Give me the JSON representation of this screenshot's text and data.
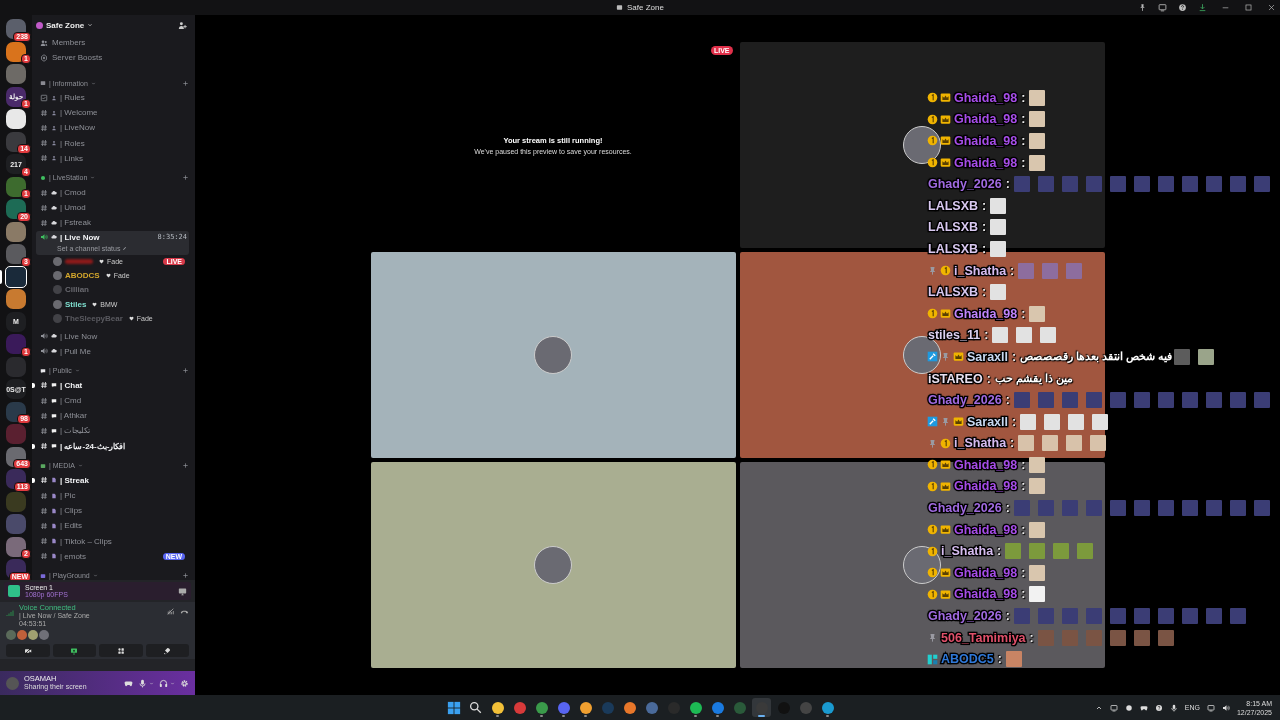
{
  "title_bar": {
    "title": "Safe Zone"
  },
  "servers": [
    {
      "color": "#5b5f6b",
      "badge": "238",
      "selected": false
    },
    {
      "color": "#d9731c",
      "badge": "1",
      "selected": false
    },
    {
      "color": "#6d6a66",
      "selected": false
    },
    {
      "color": "#4a2a6a",
      "label": "حولة",
      "badge": "1",
      "selected": false
    },
    {
      "color": "#e8e8e8",
      "selected": false
    },
    {
      "color": "#3a3a3e",
      "badge": "14",
      "selected": false
    },
    {
      "color": "#1e1f22",
      "label": "217",
      "badge": "4",
      "selected": false
    },
    {
      "color": "#3d6b2e",
      "badge": "1",
      "selected": false
    },
    {
      "color": "#1d6b55",
      "badge": "20",
      "selected": false
    },
    {
      "color": "#8a7a66",
      "selected": false
    },
    {
      "color": "#5a5a5e",
      "badge": "3",
      "selected": false
    },
    {
      "color": "#1a2a3a",
      "selected": true
    },
    {
      "color": "#c87a30",
      "selected": false
    },
    {
      "color": "#1e1f22",
      "label": "M",
      "selected": false
    },
    {
      "color": "#3a1a5a",
      "badge": "1",
      "selected": false
    },
    {
      "color": "#2a2a2e",
      "selected": false
    },
    {
      "color": "#1e1f22",
      "label": "0S@T",
      "selected": false
    },
    {
      "color": "#2a3a4a",
      "badge": "98",
      "selected": false
    },
    {
      "color": "#5a2030",
      "selected": false
    },
    {
      "color": "#6a6a70",
      "badge": "643",
      "selected": false
    },
    {
      "color": "#3a2a5a",
      "badge": "113",
      "selected": false
    },
    {
      "color": "#3a3a20",
      "selected": false
    },
    {
      "color": "#4a4a6a",
      "selected": false
    },
    {
      "color": "#7a6a7a",
      "badge": "2",
      "selected": false
    },
    {
      "color": "#3a2a5a",
      "badge": "NEW",
      "selected": false
    }
  ],
  "server": {
    "name": "Safe Zone",
    "links": [
      {
        "label": "Members",
        "kind": "members"
      },
      {
        "label": "Server Boosts",
        "kind": "boost"
      }
    ]
  },
  "categories": [
    {
      "name": "| Information",
      "kind": "info",
      "channels": [
        {
          "name": "| Rules",
          "kind": "rules",
          "selected": false,
          "unread": false
        },
        {
          "name": "| Welcome",
          "kind": "text",
          "selected": false,
          "unread": false
        },
        {
          "name": "| LiveNow",
          "kind": "text",
          "selected": false,
          "unread": false
        },
        {
          "name": "| Roles",
          "kind": "text",
          "selected": false,
          "unread": false
        },
        {
          "name": "| Links",
          "kind": "text",
          "selected": false,
          "unread": false
        }
      ]
    },
    {
      "name": "| LiveStation",
      "kind": "live",
      "channels": [
        {
          "name": "| Cmod",
          "kind": "text",
          "selected": false,
          "unread": false
        },
        {
          "name": "| Umod",
          "kind": "text",
          "selected": false,
          "unread": false
        },
        {
          "name": "| Fstreak",
          "kind": "text",
          "selected": false,
          "unread": false
        },
        {
          "name": "| Live Now",
          "kind": "voice",
          "selected": true,
          "unread": true,
          "timer": "8:35:24",
          "status": "Set a channel status",
          "members": [
            {
              "redacted": true,
              "color": "#8a1a1a",
              "tag": "Fade",
              "live": "LIVE",
              "dimmed": false
            },
            {
              "name": "ABODCS",
              "color": "#d4a72c",
              "tag": "Fade",
              "dimmed": false
            },
            {
              "name": "Cillian",
              "color": "#6a6a70",
              "dimmed": true
            },
            {
              "name": "Stiles",
              "color": "#7fe0d0",
              "tag": "BMW",
              "dimmed": false
            },
            {
              "name": "TheSleepyBear",
              "color": "#5a5a60",
              "tag": "Fade",
              "dimmed": true
            }
          ]
        },
        {
          "name": "| Live Now",
          "kind": "voice",
          "selected": false,
          "unread": false
        },
        {
          "name": "| Pull Me",
          "kind": "voice",
          "selected": false,
          "unread": false
        }
      ]
    },
    {
      "name": "| Public",
      "kind": "chat",
      "channels": [
        {
          "name": "| Chat",
          "kind": "text",
          "selected": false,
          "unread": true
        },
        {
          "name": "| Cmd",
          "kind": "text",
          "selected": false,
          "unread": false
        },
        {
          "name": "| Athkar",
          "kind": "text",
          "selected": false,
          "unread": false
        },
        {
          "name": "| تكليجات",
          "kind": "text",
          "selected": false,
          "unread": false
        },
        {
          "name": "| افكار-بث-24-ساعه",
          "kind": "text",
          "selected": false,
          "unread": true
        }
      ]
    },
    {
      "name": "| MEDIA",
      "kind": "media",
      "channels": [
        {
          "name": "| Streak",
          "kind": "text",
          "selected": false,
          "unread": true
        },
        {
          "name": "| Pic",
          "kind": "text",
          "selected": false,
          "unread": false
        },
        {
          "name": "| Clips",
          "kind": "text",
          "selected": false,
          "unread": false
        },
        {
          "name": "| Edits",
          "kind": "text",
          "selected": false,
          "unread": false
        },
        {
          "name": "| Tiktok – Clips",
          "kind": "text",
          "selected": false,
          "unread": false
        },
        {
          "name": "| emots",
          "kind": "text",
          "selected": false,
          "unread": false,
          "badge": "NEW"
        }
      ]
    },
    {
      "name": "| PlayGround",
      "kind": "game"
    }
  ],
  "screen_share": {
    "title": "Screen 1",
    "quality": "1080p 60FPS"
  },
  "voice": {
    "status": "Voice Connected",
    "channel": "| Live Now / Safe Zone",
    "elapsed": "04:53:51",
    "participants": [
      {
        "color": "#5a6a5a"
      },
      {
        "color": "#c0603a"
      },
      {
        "color": "#a0a070"
      },
      {
        "color": "#707078"
      }
    ]
  },
  "user": {
    "name": "OSAMAH",
    "status": "Sharing their screen"
  },
  "tiles": [
    {
      "kind": "stream",
      "live": "LIVE",
      "title": "Your stream is still running!",
      "message": "We've paused this preview to save your resources."
    },
    {
      "kind": "avatar",
      "color": "#1e1e1e"
    },
    {
      "kind": "avatar",
      "color": "#a4b3ba"
    },
    {
      "kind": "avatar",
      "color": "#a1563f"
    },
    {
      "kind": "avatar",
      "color": "#a9ae91"
    },
    {
      "kind": "avatar",
      "color": "#5b595d"
    }
  ],
  "chat": [
    {
      "user": "Ghaida_98",
      "sep": ":",
      "color": "#a64de8",
      "badges": [
        {
          "kind": "coin"
        },
        {
          "kind": "crown"
        }
      ],
      "emotes": [
        {
          "kind": "ghaida"
        }
      ]
    },
    {
      "user": "Ghaida_98",
      "sep": ":",
      "color": "#a64de8",
      "badges": [
        {
          "kind": "coin"
        },
        {
          "kind": "crown"
        }
      ],
      "emotes": [
        {
          "kind": "ghaida"
        }
      ]
    },
    {
      "user": "Ghaida_98",
      "sep": ":",
      "color": "#a64de8",
      "badges": [
        {
          "kind": "coin"
        },
        {
          "kind": "crown"
        }
      ],
      "emotes": [
        {
          "kind": "ghaida"
        }
      ]
    },
    {
      "user": "Ghaida_98",
      "sep": ":",
      "color": "#a64de8",
      "badges": [
        {
          "kind": "coin"
        },
        {
          "kind": "crown"
        }
      ],
      "emotes": [
        {
          "kind": "ghaida"
        }
      ]
    },
    {
      "user": "Ghady_2026",
      "sep": ":",
      "color": "#a06ae0",
      "emotes": [
        {
          "kind": "ghady"
        },
        {
          "kind": "ghady"
        },
        {
          "kind": "ghady"
        },
        {
          "kind": "ghady"
        },
        {
          "kind": "ghady"
        },
        {
          "kind": "ghady"
        },
        {
          "kind": "ghady"
        },
        {
          "kind": "ghady"
        },
        {
          "kind": "ghady"
        },
        {
          "kind": "ghady"
        },
        {
          "kind": "ghady"
        }
      ]
    },
    {
      "user": "LALSXB",
      "sep": ":",
      "color": "#d8c8f0",
      "emotes": [
        {
          "kind": "lalsxb"
        }
      ]
    },
    {
      "user": "LALSXB",
      "sep": ":",
      "color": "#d8c8f0",
      "emotes": [
        {
          "kind": "lalsxb"
        }
      ]
    },
    {
      "user": "LALSXB",
      "sep": ":",
      "color": "#d8c8f0",
      "emotes": [
        {
          "kind": "lalsxb"
        }
      ]
    },
    {
      "user": "i_Shatha",
      "sep": ":",
      "color": "#d6bcf0",
      "badges": [
        {
          "kind": "pin"
        },
        {
          "kind": "coin"
        }
      ],
      "emotes": [
        {
          "kind": "pinkbird"
        },
        {
          "kind": "pinkbird"
        },
        {
          "kind": "pinkbird"
        }
      ]
    },
    {
      "user": "LALSXB",
      "sep": ":",
      "color": "#d8c8f0",
      "emotes": [
        {
          "kind": "lalsxb"
        }
      ]
    },
    {
      "user": "Ghaida_98",
      "sep": ":",
      "color": "#c084fc",
      "badges": [
        {
          "kind": "coin"
        },
        {
          "kind": "crown"
        }
      ],
      "emotes": [
        {
          "kind": "ghaida"
        }
      ]
    },
    {
      "user": "stiles_11",
      "sep": ":",
      "color": "#dcd0f0",
      "emotes": [
        {
          "kind": "lalsxb"
        },
        {
          "kind": "lalsxb"
        },
        {
          "kind": "lalsxb"
        }
      ]
    },
    {
      "user": "Saraxll",
      "sep": ":",
      "color": "#c8d8f0",
      "badges": [
        {
          "kind": "mod"
        },
        {
          "kind": "pin"
        },
        {
          "kind": "crown"
        }
      ],
      "text": "فيه شخص انتقد بعدها رقصصصص",
      "emotes": [
        {
          "kind": "man"
        },
        {
          "kind": "face"
        }
      ]
    },
    {
      "user": "iSTAREO",
      "sep": ":",
      "color": "#e8e0f0",
      "text": "مين ذا يقشم حب"
    },
    {
      "user": "Ghady_2026",
      "sep": ":",
      "color": "#a06ae0",
      "emotes": [
        {
          "kind": "ghady"
        },
        {
          "kind": "ghady"
        },
        {
          "kind": "ghady"
        },
        {
          "kind": "ghady"
        },
        {
          "kind": "ghady"
        },
        {
          "kind": "ghady"
        },
        {
          "kind": "ghady"
        },
        {
          "kind": "ghady"
        },
        {
          "kind": "ghady"
        },
        {
          "kind": "ghady"
        },
        {
          "kind": "ghady"
        }
      ]
    },
    {
      "user": "Saraxll",
      "sep": ":",
      "color": "#c8d8f0",
      "badges": [
        {
          "kind": "mod"
        },
        {
          "kind": "pin"
        },
        {
          "kind": "crown"
        }
      ],
      "emotes": [
        {
          "kind": "lalsxb"
        },
        {
          "kind": "lalsxb"
        },
        {
          "kind": "lalsxb"
        },
        {
          "kind": "lalsxb"
        }
      ]
    },
    {
      "user": "i_Shatha",
      "sep": ":",
      "color": "#d6bcf0",
      "badges": [
        {
          "kind": "pin"
        },
        {
          "kind": "coin"
        }
      ],
      "emotes": [
        {
          "kind": "pale"
        },
        {
          "kind": "pale"
        },
        {
          "kind": "pale"
        },
        {
          "kind": "pale"
        }
      ]
    },
    {
      "user": "Ghaida_98",
      "sep": ":",
      "color": "#a64de8",
      "badges": [
        {
          "kind": "coin"
        },
        {
          "kind": "crown"
        }
      ],
      "emotes": [
        {
          "kind": "ghaida"
        }
      ]
    },
    {
      "user": "Ghaida_98",
      "sep": ":",
      "color": "#a64de8",
      "badges": [
        {
          "kind": "coin"
        },
        {
          "kind": "crown"
        }
      ],
      "emotes": [
        {
          "kind": "ghaida"
        }
      ]
    },
    {
      "user": "Ghady_2026",
      "sep": ":",
      "color": "#a06ae0",
      "emotes": [
        {
          "kind": "ghady"
        },
        {
          "kind": "ghady"
        },
        {
          "kind": "ghady"
        },
        {
          "kind": "ghady"
        },
        {
          "kind": "ghady"
        },
        {
          "kind": "ghady"
        },
        {
          "kind": "ghady"
        },
        {
          "kind": "ghady"
        },
        {
          "kind": "ghady"
        },
        {
          "kind": "ghady"
        },
        {
          "kind": "ghady"
        }
      ]
    },
    {
      "user": "Ghaida_98",
      "sep": ":",
      "color": "#a64de8",
      "badges": [
        {
          "kind": "coin"
        },
        {
          "kind": "crown"
        }
      ],
      "emotes": [
        {
          "kind": "ghaida"
        }
      ]
    },
    {
      "user": "i_Shatha",
      "sep": ":",
      "color": "#d6bcf0",
      "badges": [
        {
          "kind": "coin"
        }
      ],
      "emotes": [
        {
          "kind": "green"
        },
        {
          "kind": "green"
        },
        {
          "kind": "green"
        },
        {
          "kind": "green"
        }
      ]
    },
    {
      "user": "Ghaida_98",
      "sep": ":",
      "color": "#a64de8",
      "badges": [
        {
          "kind": "coin"
        },
        {
          "kind": "crown"
        }
      ],
      "emotes": [
        {
          "kind": "ghaida"
        }
      ]
    },
    {
      "user": "Ghaida_98",
      "sep": ":",
      "color": "#a64de8",
      "badges": [
        {
          "kind": "coin"
        },
        {
          "kind": "crown"
        }
      ],
      "emotes": [
        {
          "kind": "hat"
        }
      ]
    },
    {
      "user": "Ghady_2026",
      "sep": ":",
      "color": "#a06ae0",
      "emotes": [
        {
          "kind": "ghady"
        },
        {
          "kind": "ghady"
        },
        {
          "kind": "ghady"
        },
        {
          "kind": "ghady"
        },
        {
          "kind": "ghady"
        },
        {
          "kind": "ghady"
        },
        {
          "kind": "ghady"
        },
        {
          "kind": "ghady"
        },
        {
          "kind": "ghady"
        },
        {
          "kind": "ghady"
        }
      ]
    },
    {
      "user": "506_Tamimiya",
      "sep": ":",
      "color": "#e0506a",
      "badges": [
        {
          "kind": "pin"
        }
      ],
      "emotes": [
        {
          "kind": "tam"
        },
        {
          "kind": "tam"
        },
        {
          "kind": "tam"
        },
        {
          "kind": "tam"
        },
        {
          "kind": "tam"
        },
        {
          "kind": "tam"
        }
      ]
    },
    {
      "user": "ABODC5",
      "sep": ":",
      "color": "#2f78d8",
      "badges": [
        {
          "kind": "sprite"
        }
      ],
      "emotes": [
        {
          "kind": "abod"
        }
      ]
    }
  ],
  "taskbar": {
    "apps": [
      {
        "kind": "windows",
        "selected": false,
        "running": false
      },
      {
        "kind": "search",
        "selected": false,
        "running": false
      },
      {
        "kind": "folder",
        "selected": false,
        "running": true
      },
      {
        "kind": "red",
        "selected": false,
        "running": false
      },
      {
        "kind": "chrome",
        "selected": false,
        "running": true
      },
      {
        "kind": "discord",
        "selected": false,
        "running": true
      },
      {
        "kind": "discord2",
        "selected": false,
        "running": true
      },
      {
        "kind": "steam",
        "selected": false,
        "running": false
      },
      {
        "kind": "orange",
        "selected": false,
        "running": false
      },
      {
        "kind": "bluecircle",
        "selected": false,
        "running": false
      },
      {
        "kind": "epic",
        "selected": false,
        "running": false
      },
      {
        "kind": "spotify",
        "selected": false,
        "running": true
      },
      {
        "kind": "bluegame",
        "selected": false,
        "running": true
      },
      {
        "kind": "xbox",
        "selected": false,
        "running": false
      },
      {
        "kind": "record",
        "selected": true,
        "running": true
      },
      {
        "kind": "g",
        "selected": false,
        "running": false
      },
      {
        "kind": "circle",
        "selected": false,
        "running": false
      },
      {
        "kind": "edge",
        "selected": false,
        "running": true
      }
    ],
    "language": "ENG",
    "time": "8:15 AM",
    "date": "12/27/2025"
  }
}
